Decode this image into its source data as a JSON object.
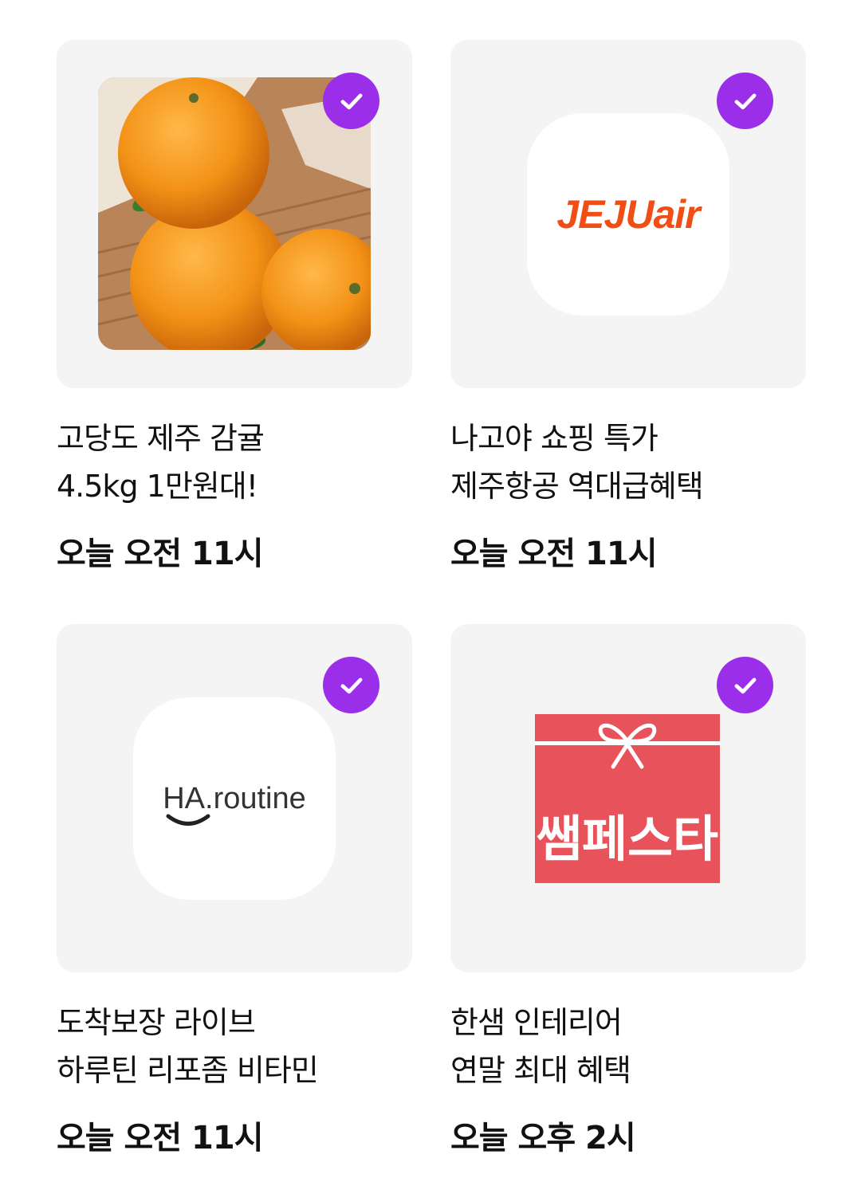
{
  "colors": {
    "check_badge": "#9b2ee8",
    "card_bg": "#f4f4f4",
    "jeju_orange": "#f04e14",
    "sale_red": "#e8525a",
    "sale_blue": "#1e3fa0"
  },
  "cards": [
    {
      "title_line1": "고당도 제주 감귤",
      "title_line2": "4.5kg 1만원대!",
      "time": "오늘 오전 11시",
      "image": "mandarin-oranges-photo",
      "checked": true
    },
    {
      "title_line1": "나고야 쇼핑 특가",
      "title_line2": "제주항공 역대급혜택",
      "time": "오늘 오전 11시",
      "logo_text": "JEJUair",
      "checked": true
    },
    {
      "title_line1": "도착보장 라이브",
      "title_line2": "하루틴 리포좀 비타민",
      "time": "오늘 오전 11시",
      "logo_text": "HA.routine",
      "checked": true
    },
    {
      "title_line1": "한샘 인테리어",
      "title_line2": "연말 최대 혜택",
      "time": "오늘 오후 2시",
      "logo_text": "쌤페스타",
      "checked": true
    }
  ]
}
